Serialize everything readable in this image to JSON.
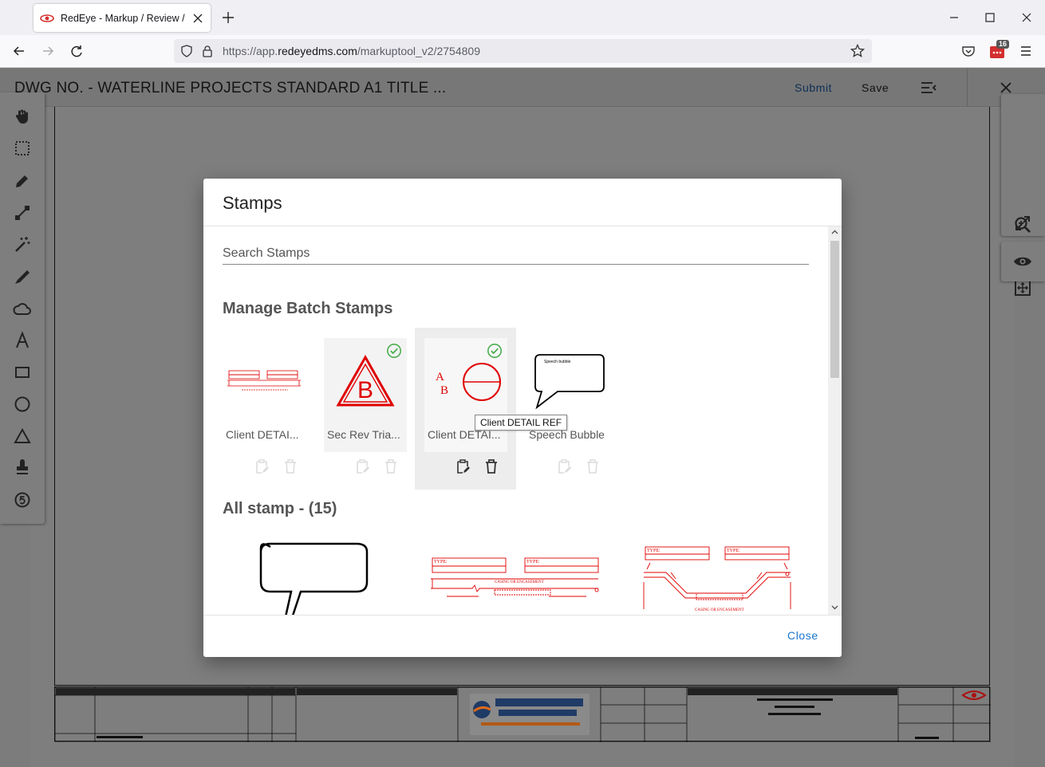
{
  "browser": {
    "tab_title": "RedEye - Markup / Review / App",
    "url_prefix": "https://app.",
    "url_host": "redeyedms.com",
    "url_path": "/markuptool_v2/2754809",
    "extension_badge": "16"
  },
  "app": {
    "title": "DWG NO. - WATERLINE PROJECTS STANDARD A1 TITLE ...",
    "submit_label": "Submit",
    "save_label": "Save"
  },
  "modal": {
    "title": "Stamps",
    "search_placeholder": "Search Stamps",
    "batch_section_title": "Manage Batch Stamps",
    "batch_stamps": [
      {
        "label": "Client DETAI...",
        "selected": false,
        "checked": false
      },
      {
        "label": "Sec Rev Tria...",
        "selected": false,
        "checked": true
      },
      {
        "label": "Client DETAI...",
        "selected": true,
        "checked": true
      },
      {
        "label": "Speech Bubble",
        "selected": false,
        "checked": false
      }
    ],
    "tooltip": "Client DETAIL REF",
    "all_section_title": "All stamp - (15)",
    "close_label": "Close"
  },
  "stamp_art": {
    "triangle_letter": "B",
    "ref_letter_a": "A",
    "ref_letter_b": "B",
    "speech_text": "Speech bubble",
    "type_label": "TYPE:",
    "casing_label": "CASING OR ENCASEMENT"
  },
  "colors": {
    "accent": "#1976d2",
    "stamp_red": "#e00000",
    "check_green": "#4caf50"
  }
}
